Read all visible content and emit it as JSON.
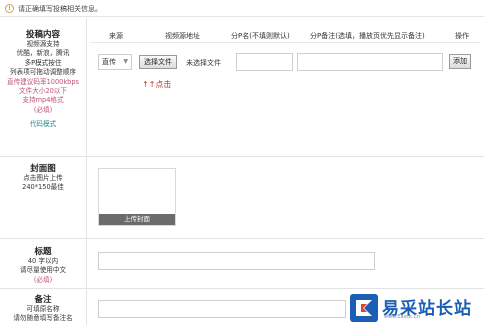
{
  "notice": {
    "icon": "info-icon",
    "text": "请正确填写投稿相关信息。"
  },
  "sections": {
    "content": {
      "title": "投稿内容",
      "lines": [
        "视频源支持",
        "优酷，新浪，腾讯",
        "多P模式按住",
        "列表项可拖动调整顺序"
      ],
      "pink_lines": [
        "直传建议码率1000kbps",
        "文件大小20以下",
        "支持mp4格式",
        "(必填)"
      ],
      "mode_link": "代码模式"
    },
    "cover": {
      "title": "封面图",
      "lines": [
        "点击图片上传",
        "240*150最佳"
      ],
      "button": "上传封面"
    },
    "title": {
      "title": "标题",
      "lines": [
        "40 字以内",
        "请尽量使用中文"
      ],
      "required": "(必填)"
    },
    "remark": {
      "title": "备注",
      "lines": [
        "可填原名称",
        "请勿随意填写备注名"
      ]
    }
  },
  "table": {
    "headers": [
      "来源",
      "视频源地址",
      "分P名(不填则默认)",
      "分P备注(选填，播放页优先显示备注)",
      "操作"
    ],
    "source_select": "直传",
    "choose_file_button": "选择文件",
    "no_file_text": "未选择文件",
    "add_button": "添加",
    "hint": "↑↑点击"
  },
  "logo": {
    "icon": "e-logo-icon",
    "text": "易采站长站",
    "url": "www.Easck.Cn"
  },
  "colors": {
    "pink": "#c0507a",
    "teal": "#2a8a8a",
    "red": "#c0392b",
    "brand": "#1a5fb4"
  }
}
